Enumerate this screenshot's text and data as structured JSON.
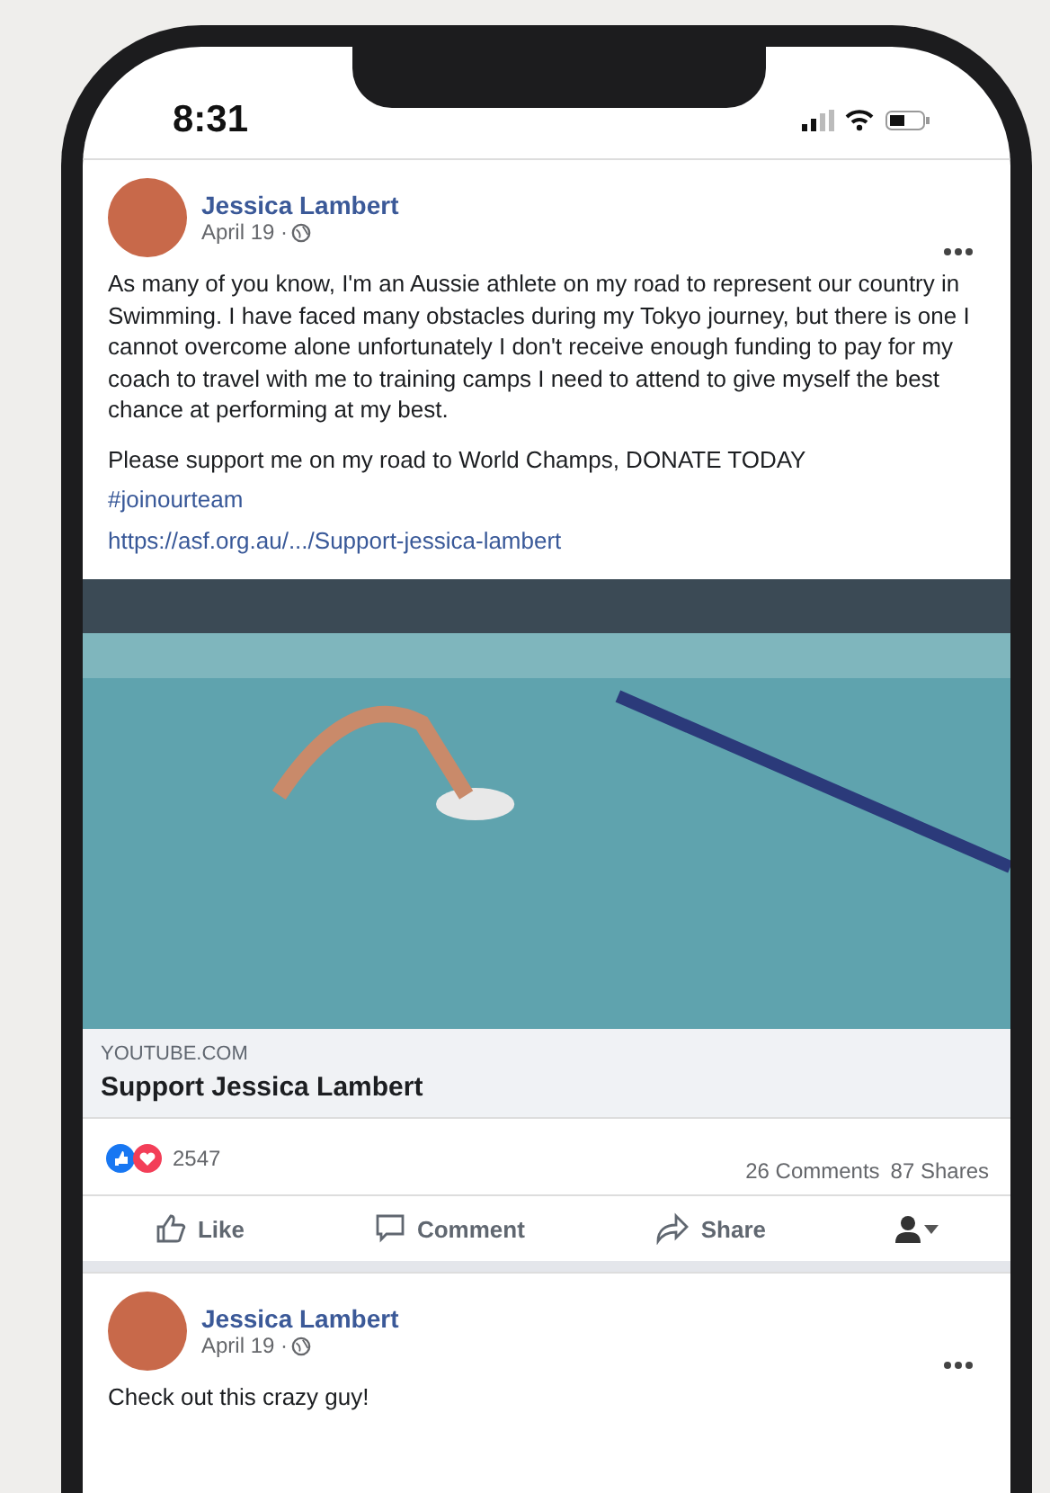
{
  "status_bar": {
    "time": "8:31"
  },
  "posts": [
    {
      "author": "Jessica Lambert",
      "date": "April 19 ·",
      "paragraphs": [
        "As many of you know, I'm an Aussie athlete on my road to represent our country in Swimming. I have faced many obstacles during my Tokyo journey, but there is one I cannot overcome alone unfortunately I don't receive enough funding to pay for my coach to travel with me to training camps I need to attend to give myself the best chance at performing at my best.",
        "Please support me on my road to World Champs, DONATE TODAY"
      ],
      "hashtag": "#joinourteam",
      "link": "https://asf.org.au/.../Support-jessica-lambert",
      "preview": {
        "source": "YOUTUBE.COM",
        "title": "Support Jessica Lambert"
      },
      "reactions": "2547",
      "comments": "26 Comments",
      "shares": "87 Shares",
      "actions": [
        "Like",
        "Comment",
        "Share"
      ]
    },
    {
      "author": "Jessica Lambert",
      "date": "April 19 ·",
      "paragraphs": [
        "Check out this crazy guy!"
      ]
    }
  ]
}
